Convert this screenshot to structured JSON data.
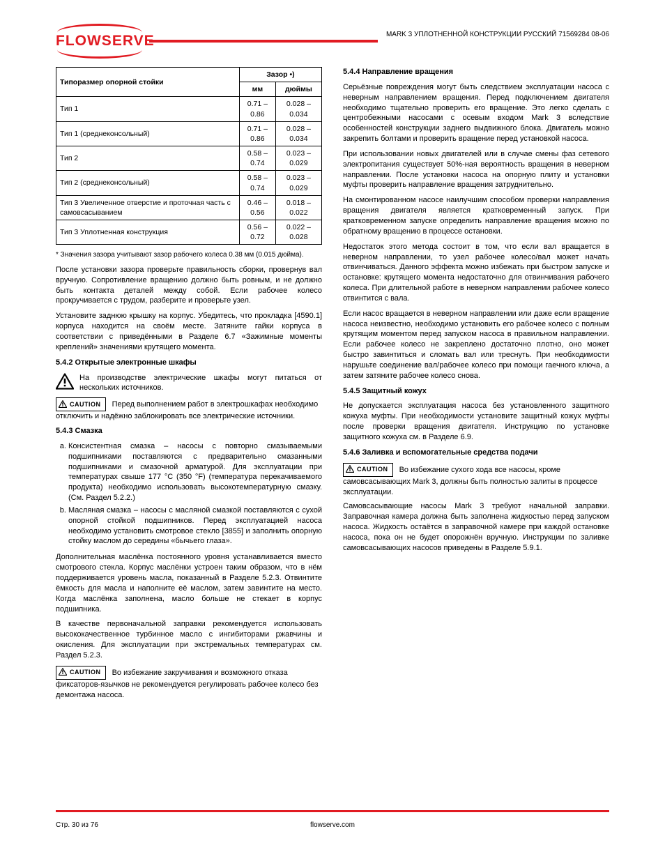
{
  "header": {
    "logo_text": "FLOWSERVE",
    "doc_ref": "MARK 3 УПЛОТНЕННОЙ КОНСТРУКЦИИ РУССКИЙ 71569284 08-06"
  },
  "left": {
    "table": {
      "col0_header": "Типоразмер опорной стойки",
      "col1_header_top": "Зазор •)",
      "col1_header_a": "мм",
      "col1_header_b": "дюймы",
      "rows": [
        [
          "Тип 1",
          "0.71 – 0.86",
          "0.028 – 0.034"
        ],
        [
          "Тип 1 (среднеконсольный)",
          "0.71 – 0.86",
          "0.028 – 0.034"
        ],
        [
          "Тип 2",
          "0.58 – 0.74",
          "0.023 – 0.029"
        ],
        [
          "Тип 2 (среднеконсольный)",
          "0.58 – 0.74",
          "0.023 – 0.029"
        ],
        [
          "Тип 3 Увеличенное отверстие и проточная часть с самовсасыванием",
          "0.46 – 0.56",
          "0.018 – 0.022"
        ],
        [
          "Тип 3 Уплотненная конструкция",
          "0.56 – 0.72",
          "0.022 – 0.028"
        ]
      ],
      "note": "* Значения зазора учитывают зазор рабочего колеса 0.38 мм (0.015 дюйма)."
    },
    "p1": "После установки зазора проверьте правильность сборки, провернув вал вручную. Сопротивление вращению должно быть ровным, и не должно быть контакта деталей между собой. Если рабочее колесо прокручивается с трудом, разберите и проверьте узел.",
    "p2": "Установите заднюю крышку на корпус. Убедитесь, что прокладка [4590.1] корпуса находится на своём месте. Затяните гайки корпуса в соответствии с приведёнными в Разделе 6.7 «Зажимные моменты креплений» значениями крутящего момента.",
    "s542_title": "5.4.2 Открытые электронные шкафы",
    "s542_warn": "На производстве электрические шкафы могут питаться от нескольких источников.",
    "s542_caution_text": "Перед выполнением работ в электрошкафах необходимо отключить и надёжно заблокировать все электрические источники.",
    "s543_title": "5.4.3 Смазка",
    "s543_a": "Консистентная смазка – насосы с повторно смазываемыми подшипниками поставляются с предварительно смазанными подшипниками и смазочной арматурой. Для эксплуатации при температурах свыше 177 °C (350 °F) (температура перекачиваемого продукта) необходимо использовать высокотемпературную смазку. (См. Раздел 5.2.2.)",
    "s543_b": "Масляная смазка – насосы с масляной смазкой поставляются с сухой опорной стойкой подшипников. Перед эксплуатацией насоса необходимо установить смотровое стекло [3855] и заполнить опорную стойку маслом до середины «бычьего глаза».",
    "s543_b2": "Дополнительная маслёнка постоянного уровня устанавливается вместо смотрового стекла. Корпус маслёнки устроен таким образом, что в нём поддерживается уровень масла, показанный в Разделе 5.2.3. Отвинтите ёмкость для масла и наполните её маслом, затем завинтите на место. Когда маслёнка заполнена, масло больше не стекает в корпус подшипника.",
    "s543_b3": "В качестве первоначальной заправки рекомендуется использовать высококачественное турбинное масло с ингибиторами ржавчины и окисления. Для эксплуатации при экстремальных температурах см. Раздел 5.2.3.",
    "s543_caution_text": "Во избежание закручивания и возможного отказа фиксаторов-язычков не рекомендуется регулировать рабочее колесо без демонтажа насоса."
  },
  "right": {
    "s544_title": "5.4.4 Направление вращения",
    "s544_p1": "Серьёзные повреждения могут быть следствием эксплуатации насоса с неверным направлением вращения. Перед подключением двигателя необходимо тщательно проверить его вращение. Это легко сделать с центробежными насосами с осевым входом Mark 3 вследствие особенностей конструкции заднего выдвижного блока. Двигатель можно закрепить болтами и проверить вращение перед установкой насоса.",
    "s544_p2": "При использовании новых двигателей или в случае смены фаз сетевого электропитания существует 50%-ная вероятность вращения в неверном направлении. После установки насоса на опорную плиту и установки муфты проверить направление вращения затруднительно.",
    "s544_p3": "На смонтированном насосе наилучшим способом проверки направления вращения двигателя является кратковременный запуск. При кратковременном запуске определить направление вращения можно по обратному вращению в процессе остановки.",
    "s544_p4": "Недостаток этого метода состоит в том, что если вал вращается в неверном направлении, то узел рабочее колесо/вал может начать отвинчиваться. Данного эффекта можно избежать при быстром запуске и остановке: крутящего момента недостаточно для отвинчивания рабочего колеса. При длительной работе в неверном направлении рабочее колесо отвинтится с вала.",
    "s544_p5": "Если насос вращается в неверном направлении или даже если вращение насоса неизвестно, необходимо установить его рабочее колесо с полным крутящим моментом перед запуском насоса в правильном направлении. Если рабочее колесо не закреплено достаточно плотно, оно может быстро завинтиться и сломать вал или треснуть. При необходимости нарушьте соединение вал/рабочее колесо при помощи гаечного ключа, а затем затяните рабочее колесо снова.",
    "s545_title": "5.4.5 Защитный кожух",
    "s545_p": "Не допускается эксплуатация насоса без установленного защитного кожуха муфты. При необходимости установите защитный кожух муфты после проверки вращения двигателя. Инструкцию по установке защитного кожуха см. в Разделе 6.9.",
    "s546_title": "5.4.6 Заливка и вспомогательные средства подачи",
    "s546_caution": "Во избежание сухого хода все насосы, кроме самовсасывающих Mark 3, должны быть полностью залиты в процессе эксплуатации.",
    "s546_p": "Самовсасывающие насосы Mark 3 требуют начальной заправки. Заправочная камера должна быть заполнена жидкостью перед запуском насоса. Жидкость остаётся в заправочной камере при каждой остановке насоса, пока он не будет опорожнён вручную. Инструкции по заливке самовсасывающих насосов приведены в Разделе 5.9.1."
  },
  "footer": {
    "left": "Стр. 30 из 76",
    "center": "flowserve.com"
  }
}
